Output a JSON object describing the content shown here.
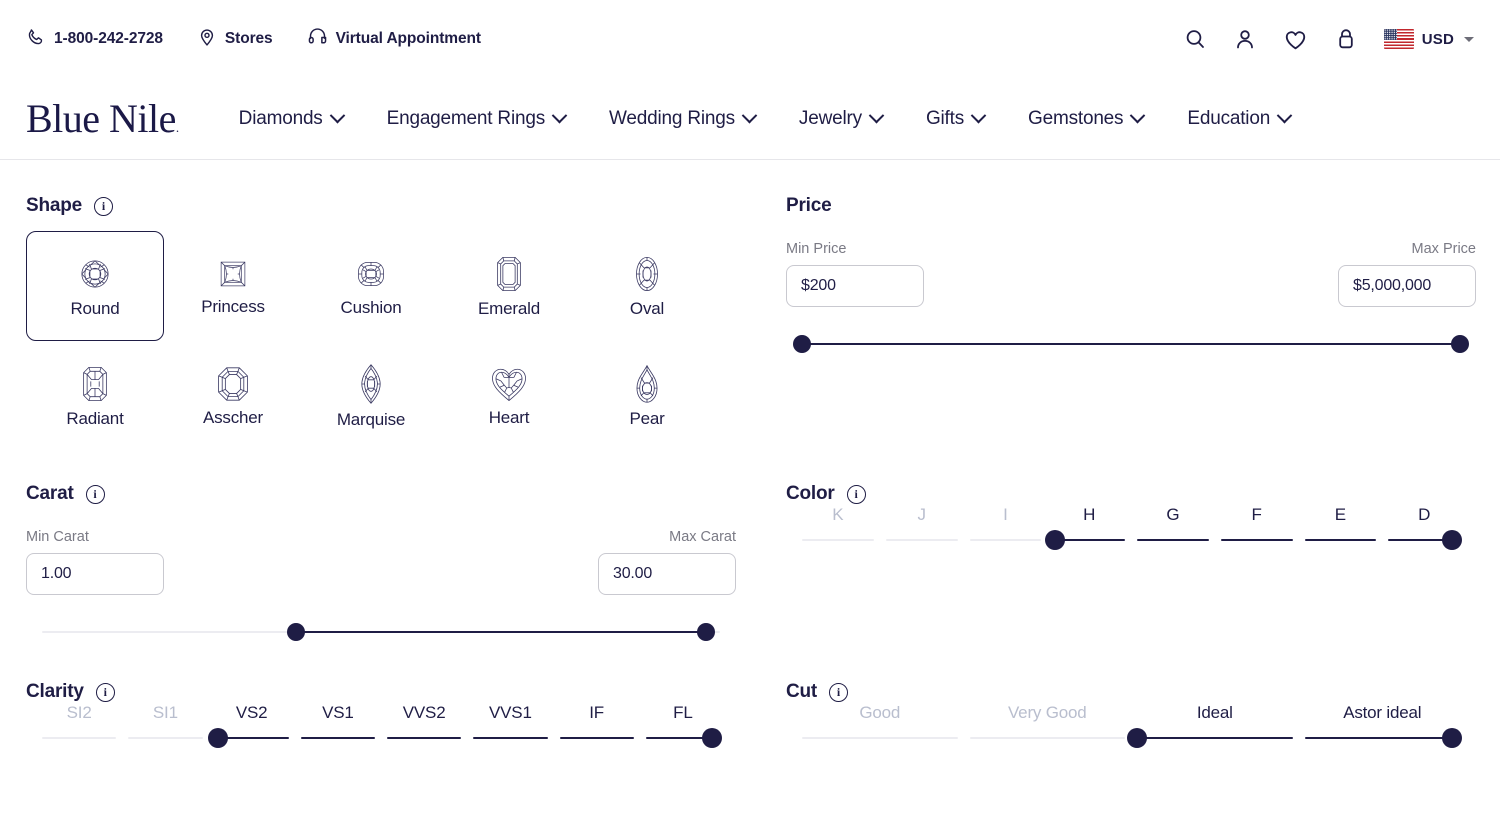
{
  "utility": {
    "phone": "1-800-242-2728",
    "stores": "Stores",
    "virtual_appointment": "Virtual Appointment",
    "currency": "USD",
    "icons": [
      "search-icon",
      "account-icon",
      "wishlist-heart-icon",
      "shopping-bag-icon",
      "us-flag-icon"
    ]
  },
  "brand": {
    "name": "Blue Nile",
    "tm": "."
  },
  "nav": {
    "items": [
      {
        "label": "Diamonds"
      },
      {
        "label": "Engagement Rings"
      },
      {
        "label": "Wedding Rings"
      },
      {
        "label": "Jewelry"
      },
      {
        "label": "Gifts"
      },
      {
        "label": "Gemstones"
      },
      {
        "label": "Education"
      }
    ]
  },
  "colors": {
    "navy": "#1f1d45",
    "track_inactive": "#ececf1",
    "label_muted": "#7a7a85",
    "label_disabled": "#b9bece",
    "border": "#c9c9d0"
  },
  "shape": {
    "title": "Shape",
    "info": "i",
    "selected": "Round",
    "row1": [
      {
        "label": "Round",
        "icon": "round-diamond-icon"
      },
      {
        "label": "Princess",
        "icon": "princess-diamond-icon"
      },
      {
        "label": "Cushion",
        "icon": "cushion-diamond-icon"
      },
      {
        "label": "Emerald",
        "icon": "emerald-diamond-icon"
      },
      {
        "label": "Oval",
        "icon": "oval-diamond-icon"
      }
    ],
    "row2": [
      {
        "label": "Radiant",
        "icon": "radiant-diamond-icon"
      },
      {
        "label": "Asscher",
        "icon": "asscher-diamond-icon"
      },
      {
        "label": "Marquise",
        "icon": "marquise-diamond-icon"
      },
      {
        "label": "Heart",
        "icon": "heart-diamond-icon"
      },
      {
        "label": "Pear",
        "icon": "pear-diamond-icon"
      }
    ]
  },
  "price": {
    "title": "Price",
    "min_label": "Min Price",
    "max_label": "Max Price",
    "min_value": "$200",
    "max_value": "$5,000,000",
    "min_pct": 0,
    "max_pct": 100
  },
  "carat": {
    "title": "Carat",
    "info": "i",
    "min_label": "Min Carat",
    "max_label": "Max Carat",
    "min_value": "1.00",
    "max_value": "30.00",
    "min_pct": 37.5,
    "max_pct": 98
  },
  "color": {
    "title": "Color",
    "info": "i",
    "grades": [
      "K",
      "J",
      "I",
      "H",
      "G",
      "F",
      "E",
      "D"
    ],
    "selected_min": "H",
    "selected_max": "D",
    "active_from_index": 3
  },
  "clarity": {
    "title": "Clarity",
    "info": "i",
    "grades": [
      "SI2",
      "SI1",
      "VS2",
      "VS1",
      "VVS2",
      "VVS1",
      "IF",
      "FL"
    ],
    "selected_min": "VS2",
    "selected_max": "FL",
    "active_from_index": 2
  },
  "cut": {
    "title": "Cut",
    "info": "i",
    "grades": [
      "Good",
      "Very Good",
      "Ideal",
      "Astor ideal"
    ],
    "selected_min": "Ideal",
    "selected_max": "Astor ideal",
    "active_from_index": 2
  }
}
